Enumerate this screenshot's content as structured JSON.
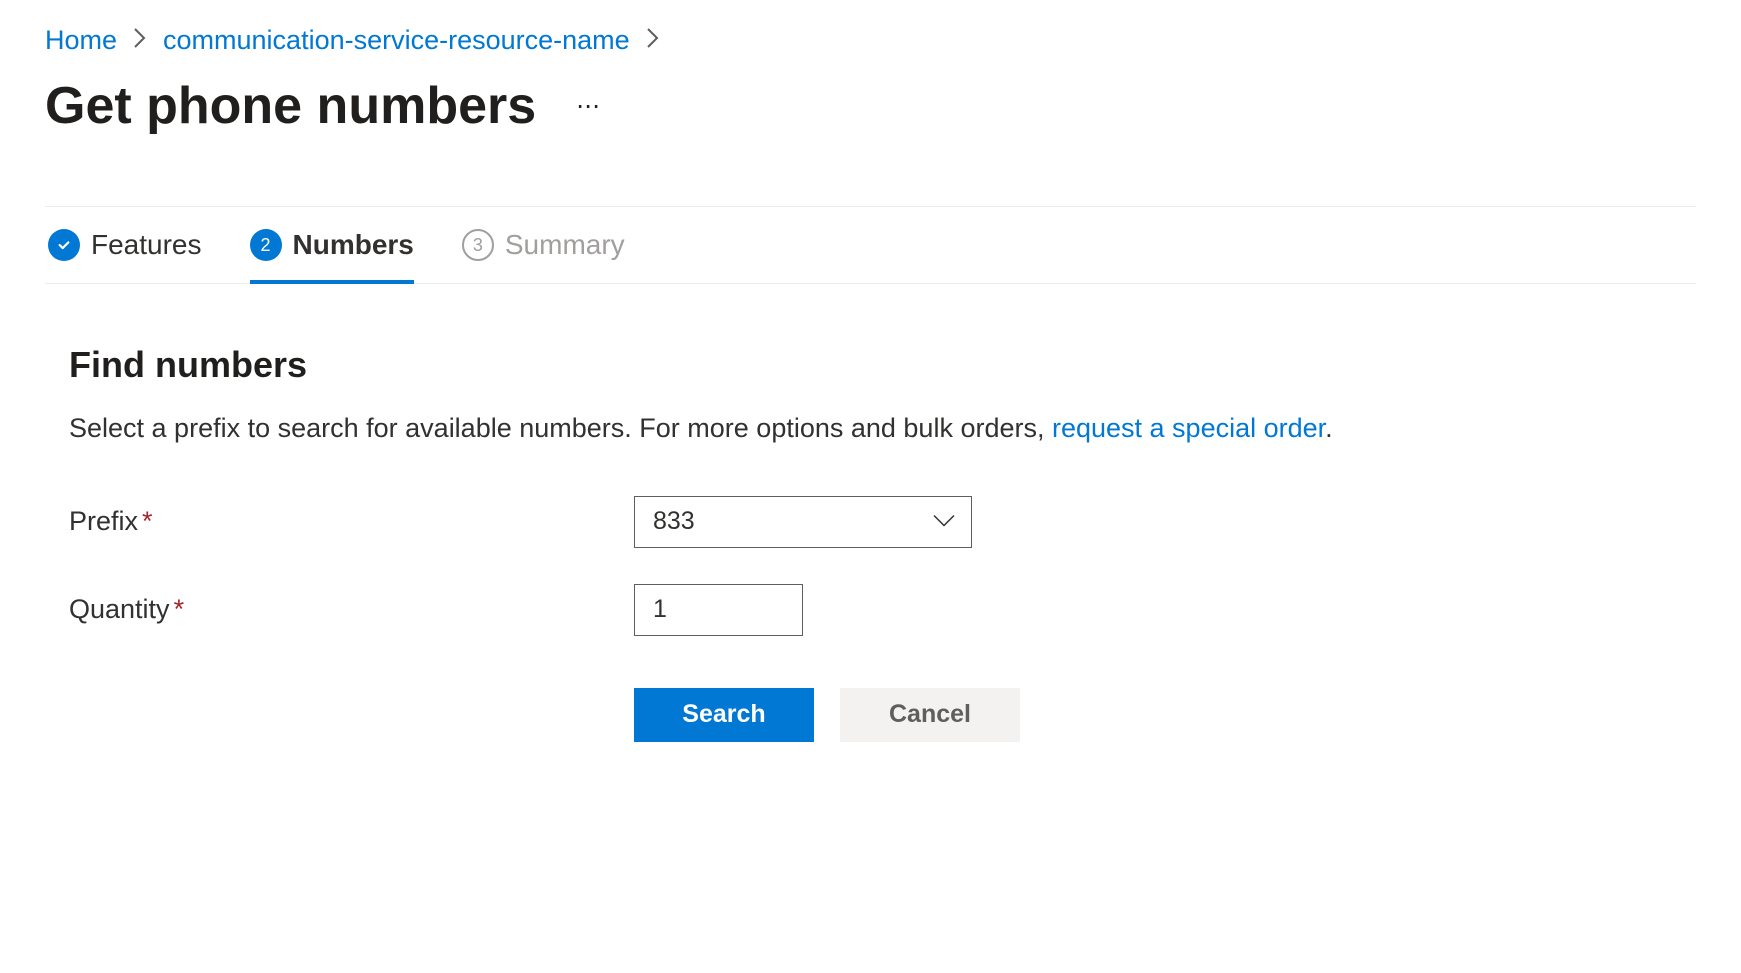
{
  "breadcrumb": {
    "items": [
      {
        "label": "Home"
      },
      {
        "label": "communication-service-resource-name"
      }
    ]
  },
  "page": {
    "title": "Get phone numbers"
  },
  "tabs": [
    {
      "label": "Features",
      "state": "completed"
    },
    {
      "label": "Numbers",
      "number": "2",
      "state": "current"
    },
    {
      "label": "Summary",
      "number": "3",
      "state": "pending"
    }
  ],
  "section": {
    "title": "Find numbers",
    "description_prefix": "Select a prefix to search for available numbers. For more options and bulk orders, ",
    "description_link": "request a special order",
    "description_suffix": "."
  },
  "form": {
    "prefix": {
      "label": "Prefix",
      "value": "833"
    },
    "quantity": {
      "label": "Quantity",
      "value": "1"
    }
  },
  "buttons": {
    "search": "Search",
    "cancel": "Cancel"
  }
}
